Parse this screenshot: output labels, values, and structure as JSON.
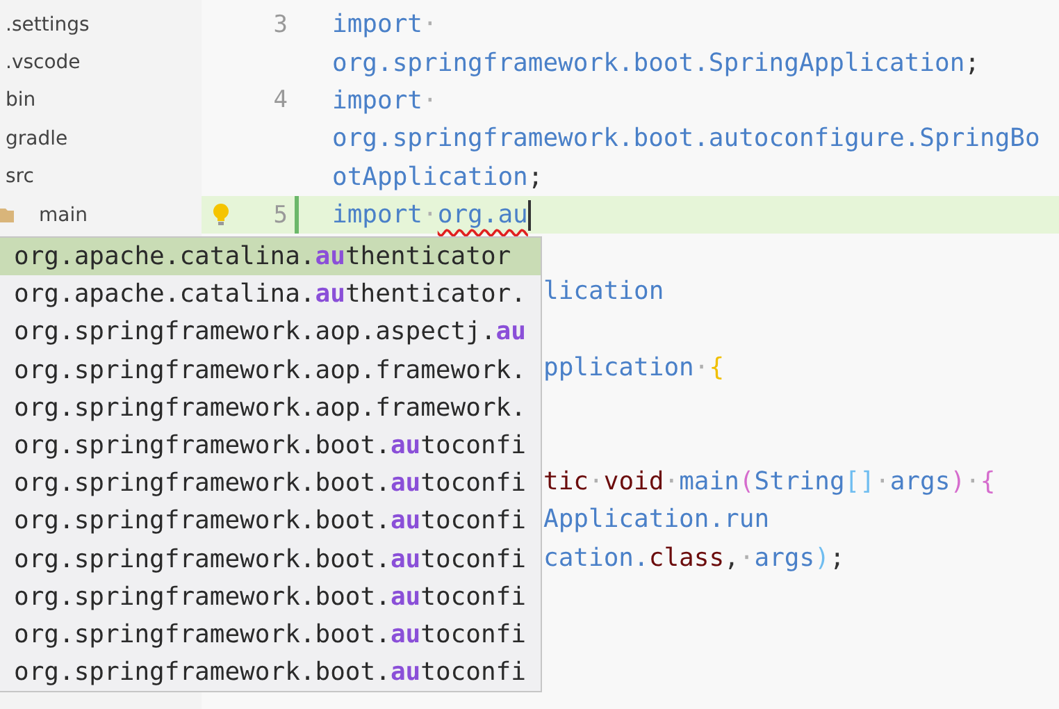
{
  "sidebar": {
    "items": [
      {
        "label": ".settings"
      },
      {
        "label": ".vscode"
      },
      {
        "label": "bin"
      },
      {
        "label": "gradle"
      },
      {
        "label": "src",
        "children": [
          {
            "label": "main"
          }
        ]
      }
    ]
  },
  "editor": {
    "lines": [
      {
        "kind": "line",
        "number": "3",
        "current": false,
        "tokens": [
          {
            "kind": "name",
            "text": "import"
          },
          {
            "kind": "ws",
            "text": "·"
          }
        ]
      },
      {
        "kind": "line",
        "current": false,
        "tokens": [
          {
            "kind": "name",
            "text": "org.springframework.boot.SpringApplication"
          },
          {
            "kind": "punct",
            "text": ";"
          }
        ]
      },
      {
        "kind": "line",
        "number": "4",
        "current": false,
        "tokens": [
          {
            "kind": "name",
            "text": "import"
          },
          {
            "kind": "ws",
            "text": "·"
          }
        ]
      },
      {
        "kind": "line",
        "current": false,
        "tokens": [
          {
            "kind": "name",
            "text": "org.springframework.boot.autoconfigure.SpringBo"
          }
        ]
      },
      {
        "kind": "line",
        "current": false,
        "tokens": [
          {
            "kind": "name",
            "text": "otApplication"
          },
          {
            "kind": "punct",
            "text": ";"
          }
        ]
      },
      {
        "kind": "line",
        "number": "5",
        "current": true,
        "tokens": [
          {
            "kind": "name",
            "text": "import"
          },
          {
            "kind": "ws",
            "text": "·"
          },
          {
            "kind": "error",
            "text": "org.au"
          }
        ]
      },
      {
        "kind": "covered",
        "current": false
      },
      {
        "kind": "covered",
        "current": false,
        "tokens": [
          {
            "kind": "name",
            "text": "lication"
          }
        ]
      },
      {
        "kind": "covered",
        "current": false
      },
      {
        "kind": "covered",
        "current": false,
        "tokens": [
          {
            "kind": "name",
            "text": "pplication"
          },
          {
            "kind": "ws",
            "text": "·"
          },
          {
            "kind": "brace",
            "text": "{"
          }
        ]
      },
      {
        "kind": "covered",
        "current": false
      },
      {
        "kind": "covered",
        "current": false
      },
      {
        "kind": "covered",
        "current": false,
        "tokens": [
          {
            "kind": "keyword",
            "text": "tic"
          },
          {
            "kind": "ws",
            "text": "·"
          },
          {
            "kind": "keyword",
            "text": "void"
          },
          {
            "kind": "ws",
            "text": "·"
          },
          {
            "kind": "name",
            "text": "main"
          },
          {
            "kind": "paren",
            "text": "("
          },
          {
            "kind": "name",
            "text": "String"
          },
          {
            "kind": "bracket",
            "text": "[]"
          },
          {
            "kind": "ws",
            "text": "·"
          },
          {
            "kind": "name",
            "text": "args"
          },
          {
            "kind": "paren",
            "text": ")"
          },
          {
            "kind": "ws",
            "text": "·"
          },
          {
            "kind": "paren",
            "text": "{"
          }
        ]
      },
      {
        "kind": "covered",
        "current": false,
        "tokens": [
          {
            "kind": "name",
            "text": "Application.run"
          }
        ]
      },
      {
        "kind": "covered",
        "current": false,
        "tokens": [
          {
            "kind": "name",
            "text": "cation."
          },
          {
            "kind": "keyword",
            "text": "class"
          },
          {
            "kind": "punct",
            "text": ","
          },
          {
            "kind": "ws",
            "text": "·"
          },
          {
            "kind": "name",
            "text": "args"
          },
          {
            "kind": "bracket",
            "text": ")"
          },
          {
            "kind": "punct",
            "text": ";"
          }
        ]
      }
    ]
  },
  "suggestions": {
    "items": [
      {
        "prefix": "org.apache.catalina.",
        "match": "au",
        "suffix": "thenticator",
        "selected": true
      },
      {
        "prefix": "org.apache.catalina.",
        "match": "au",
        "suffix": "thenticator.",
        "selected": false
      },
      {
        "prefix": "org.springframework.aop.aspectj.",
        "match": "au",
        "selected": false
      },
      {
        "prefix": "org.springframework.aop.framework.",
        "selected": false
      },
      {
        "prefix": "org.springframework.aop.framework.",
        "selected": false
      },
      {
        "prefix": "org.springframework.boot.",
        "match": "au",
        "suffix": "toconfi",
        "selected": false
      },
      {
        "prefix": "org.springframework.boot.",
        "match": "au",
        "suffix": "toconfi",
        "selected": false
      },
      {
        "prefix": "org.springframework.boot.",
        "match": "au",
        "suffix": "toconfi",
        "selected": false
      },
      {
        "prefix": "org.springframework.boot.",
        "match": "au",
        "suffix": "toconfi",
        "selected": false
      },
      {
        "prefix": "org.springframework.boot.",
        "match": "au",
        "suffix": "toconfi",
        "selected": false
      },
      {
        "prefix": "org.springframework.boot.",
        "match": "au",
        "suffix": "toconfi",
        "selected": false
      },
      {
        "prefix": "org.springframework.boot.",
        "match": "au",
        "suffix": "toconfi",
        "selected": false
      }
    ]
  }
}
